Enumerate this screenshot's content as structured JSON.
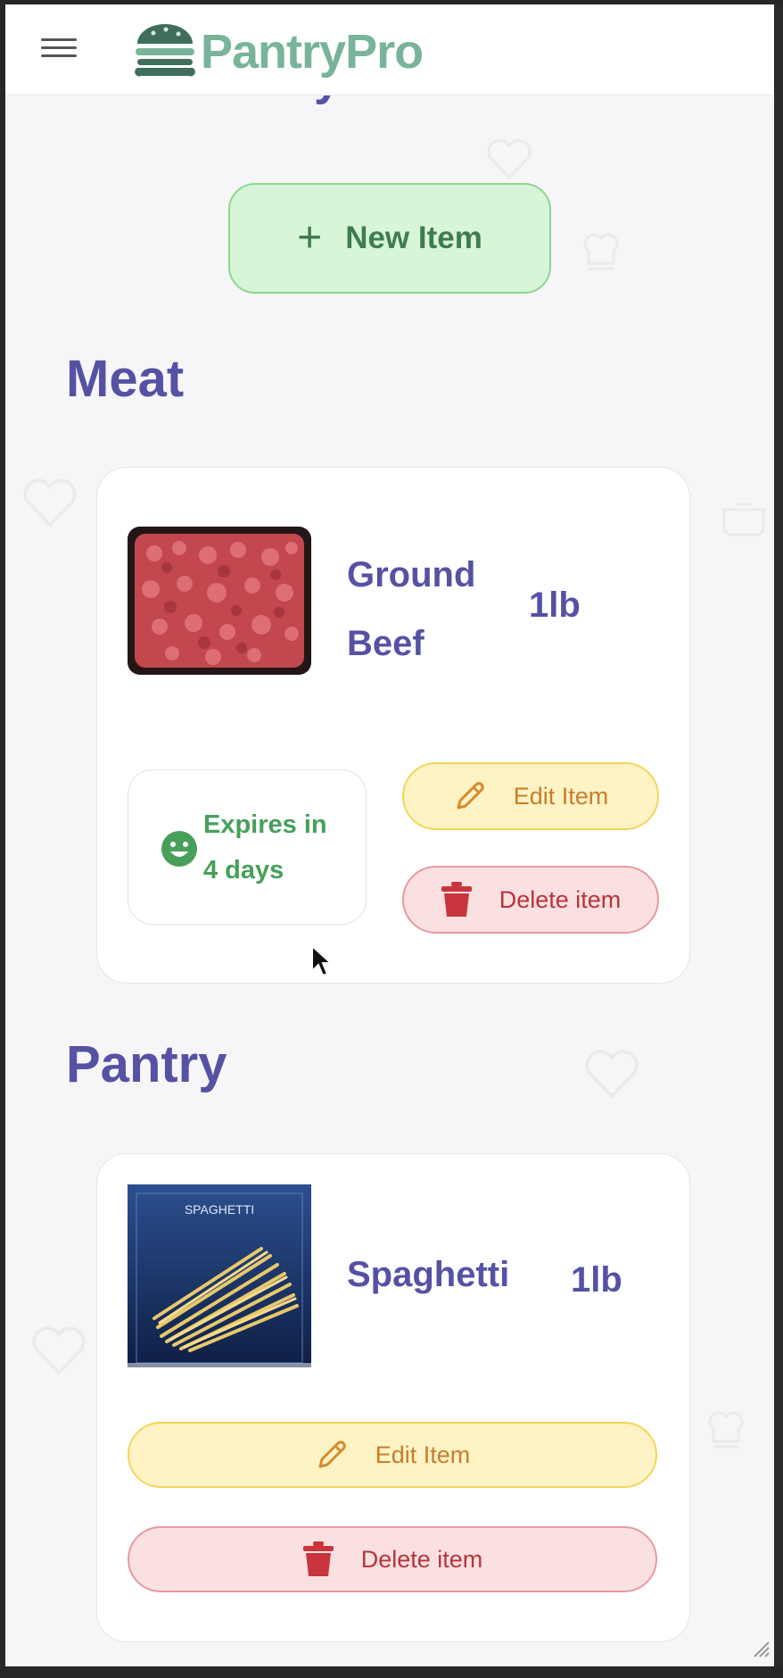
{
  "app": {
    "name": "PantryPro",
    "brand_color": "#78b49a",
    "accent_color": "#5552a4"
  },
  "header": {
    "menu_icon": "hamburger-menu-icon",
    "logo_icon": "burger-icon"
  },
  "page": {
    "title": "Your Pantry",
    "new_item_label": "New Item",
    "new_item_icon": "plus-icon"
  },
  "sections": [
    {
      "title": "Meat",
      "items": [
        {
          "name_line1": "Ground",
          "name_line2": "Beef",
          "quantity": "1lb",
          "image": "ground-beef-photo",
          "expiry_line1": "Expires in",
          "expiry_line2": "4 days",
          "expiry_icon": "smile-icon",
          "edit_label": "Edit Item",
          "delete_label": "Delete item"
        }
      ]
    },
    {
      "title": "Pantry",
      "items": [
        {
          "name": "Spaghetti",
          "quantity": "1lb",
          "image": "spaghetti-photo",
          "package_label": "SPAGHETTI",
          "edit_label": "Edit Item",
          "delete_label": "Delete item"
        }
      ]
    }
  ],
  "colors": {
    "edit_bg": "#fdf3c4",
    "delete_bg": "#fbe0e2",
    "new_item_bg": "#d7f5d7",
    "expiry_text": "#47a05a"
  }
}
